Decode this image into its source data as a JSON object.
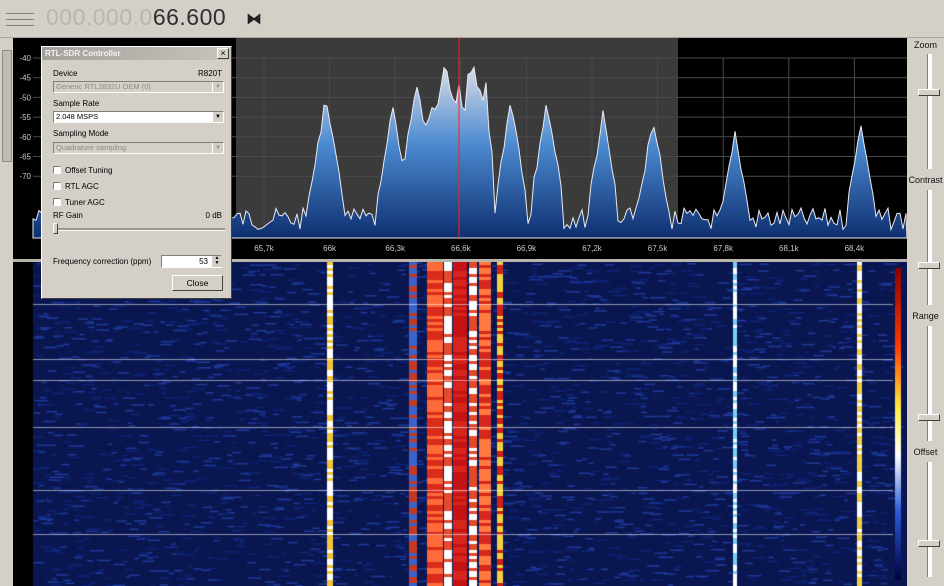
{
  "frequency": {
    "dim_part": "000.000.0",
    "bright_part": "66.600"
  },
  "spectrum": {
    "db_labels": [
      "-40",
      "-45",
      "-50",
      "-55",
      "-60",
      "-65",
      "-70"
    ],
    "freq_labels": [
      "65,7k",
      "66k",
      "66,3k",
      "66,6k",
      "66,9k",
      "67,2k",
      "67,5k",
      "67,8k",
      "68,1k",
      "68,4k"
    ]
  },
  "right_panel": {
    "zoom": "Zoom",
    "contrast": "Contrast",
    "range": "Range",
    "offset": "Offset"
  },
  "dialog": {
    "title": "RTL-SDR Controller",
    "close_x": "×",
    "device_label": "Device",
    "tuner": "R820T",
    "device_value": "Generic RTL2832U OEM (0)",
    "sample_rate_label": "Sample Rate",
    "sample_rate_value": "2.048 MSPS",
    "sampling_mode_label": "Sampling Mode",
    "sampling_mode_value": "Quadrature sampling",
    "offset_tuning": "Offset Tuning",
    "rtl_agc": "RTL AGC",
    "tuner_agc": "Tuner AGC",
    "rf_gain_label": "RF Gain",
    "rf_gain_value": "0 dB",
    "freq_corr_label": "Frequency correction (ppm)",
    "freq_corr_value": "53",
    "close_button": "Close"
  },
  "colors": {
    "spectrum_fill": "#2f6fb5",
    "waterfall_bg": "#0b1a5a",
    "center_line": "#ff2020"
  }
}
